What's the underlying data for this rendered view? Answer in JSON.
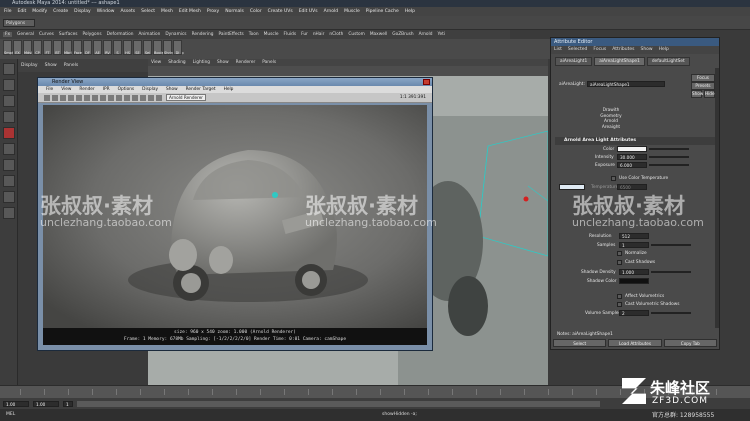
{
  "app": {
    "title": "Autodesk Maya 2014: untitled* --- ashape1"
  },
  "menubar": [
    "File",
    "Edit",
    "Modify",
    "Create",
    "Display",
    "Window",
    "Assets",
    "Select",
    "Mesh",
    "Edit Mesh",
    "Proxy",
    "Normals",
    "Color",
    "Create UVs",
    "Edit UVs",
    "Arnold",
    "Muscle",
    "Pipeline Cache",
    "Help"
  ],
  "status": {
    "mode": "Polygons"
  },
  "shelf_tabs": [
    "Fx",
    "General",
    "Curves",
    "Surfaces",
    "Polygons",
    "Deformation",
    "Animation",
    "Dynamics",
    "Rendering",
    "PaintEffects",
    "Toon",
    "Muscle",
    "Fluids",
    "Fur",
    "nHair",
    "nCloth",
    "Custom",
    "Maxwell",
    "GoZBrush",
    "Arnold",
    "Yeti"
  ],
  "shelf_icons": [
    "Smpte",
    "EX",
    "Mdsl",
    "CP",
    "FT",
    "BT",
    "Mbrl",
    "Face",
    "DF",
    "AE",
    "RV",
    "S",
    "HS",
    "SE",
    "Sel",
    "Boolean",
    "Shrinkwrap",
    "Dl"
  ],
  "left_panel": [
    "Display",
    "Show",
    "Panels"
  ],
  "viewport_menu": [
    "View",
    "Shading",
    "Lighting",
    "Show",
    "Renderer",
    "Panels"
  ],
  "render_view": {
    "title": "Render View",
    "menus": [
      "File",
      "View",
      "Render",
      "IPR",
      "Options",
      "Display",
      "Show",
      "Render Target",
      "Help"
    ],
    "renderer": "Arnold Renderer",
    "zoom": "1:1",
    "ratio": "1:1 391:391",
    "info_line1": "size: 960 x 540  zoom: 1.000    (Arnold Renderer)",
    "info_line2": "Frame: 1    Memory: 678Mb   Sampling: [-1/2/2/2/2/0]   Render Time: 0:01   Camera: camShape"
  },
  "attribute_editor": {
    "title": "Attribute Editor",
    "menus": [
      "List",
      "Selected",
      "Focus",
      "Attributes",
      "Show",
      "Help"
    ],
    "tabs": [
      "aiAreaLight1",
      "aiAreaLightShape1",
      "defaultLightSet"
    ],
    "buttons": {
      "focus": "Focus",
      "presets": "Presets",
      "show": "Show",
      "hide": "Hide"
    },
    "shape_label": "aiAreaLight:",
    "shape_value": "aiAreaLightShape1",
    "display_items": [
      "Drawith",
      "Geometry",
      "Arnold",
      "Areaight"
    ],
    "section": "Arnold Area Light Attributes",
    "color_label": "Color",
    "intensity_label": "Intensity",
    "intensity_value": "30.000",
    "exposure_label": "Exposure",
    "exposure_value": "6.000",
    "use_color_temp": "Use Color Temperature",
    "temperature_label": "Temperature",
    "temperature_value": "6500",
    "resolution_label": "Resolution",
    "resolution_value": "512",
    "samples_label": "Samples",
    "samples_value": "1",
    "normalize": "Normalize",
    "cast_shadows": "Cast Shadows",
    "shadow_density_label": "Shadow Density",
    "shadow_density_value": "1.000",
    "shadow_color_label": "Shadow Color",
    "affect_volumetrics": "Affect Volumetrics",
    "cast_volumetric_shadows": "Cast Volumetric Shadows",
    "volume_samples_label": "Volume Samples",
    "volume_samples_value": "2",
    "notes_label": "Notes: aiAreaLightShape1",
    "bottom_buttons": [
      "Select",
      "Load Attributes",
      "Copy Tab"
    ]
  },
  "timeline": {
    "start": "1.00",
    "end": "1.00",
    "current": "1",
    "cmd": "MEL",
    "status": "showHidden -a;"
  },
  "watermarks": {
    "cn": "张叔叔·素材",
    "url": "unclezhang.taobao.com",
    "logo": "朱峰社区",
    "logo_url": "ZF3D.COM",
    "logo_sub": "官方总群: 128958555"
  },
  "colors": {
    "accent_title": "#3a5a80",
    "render_bg": "#7a8fa8",
    "scene_cyan": "#2fc9c4",
    "light_red": "#d42020"
  }
}
